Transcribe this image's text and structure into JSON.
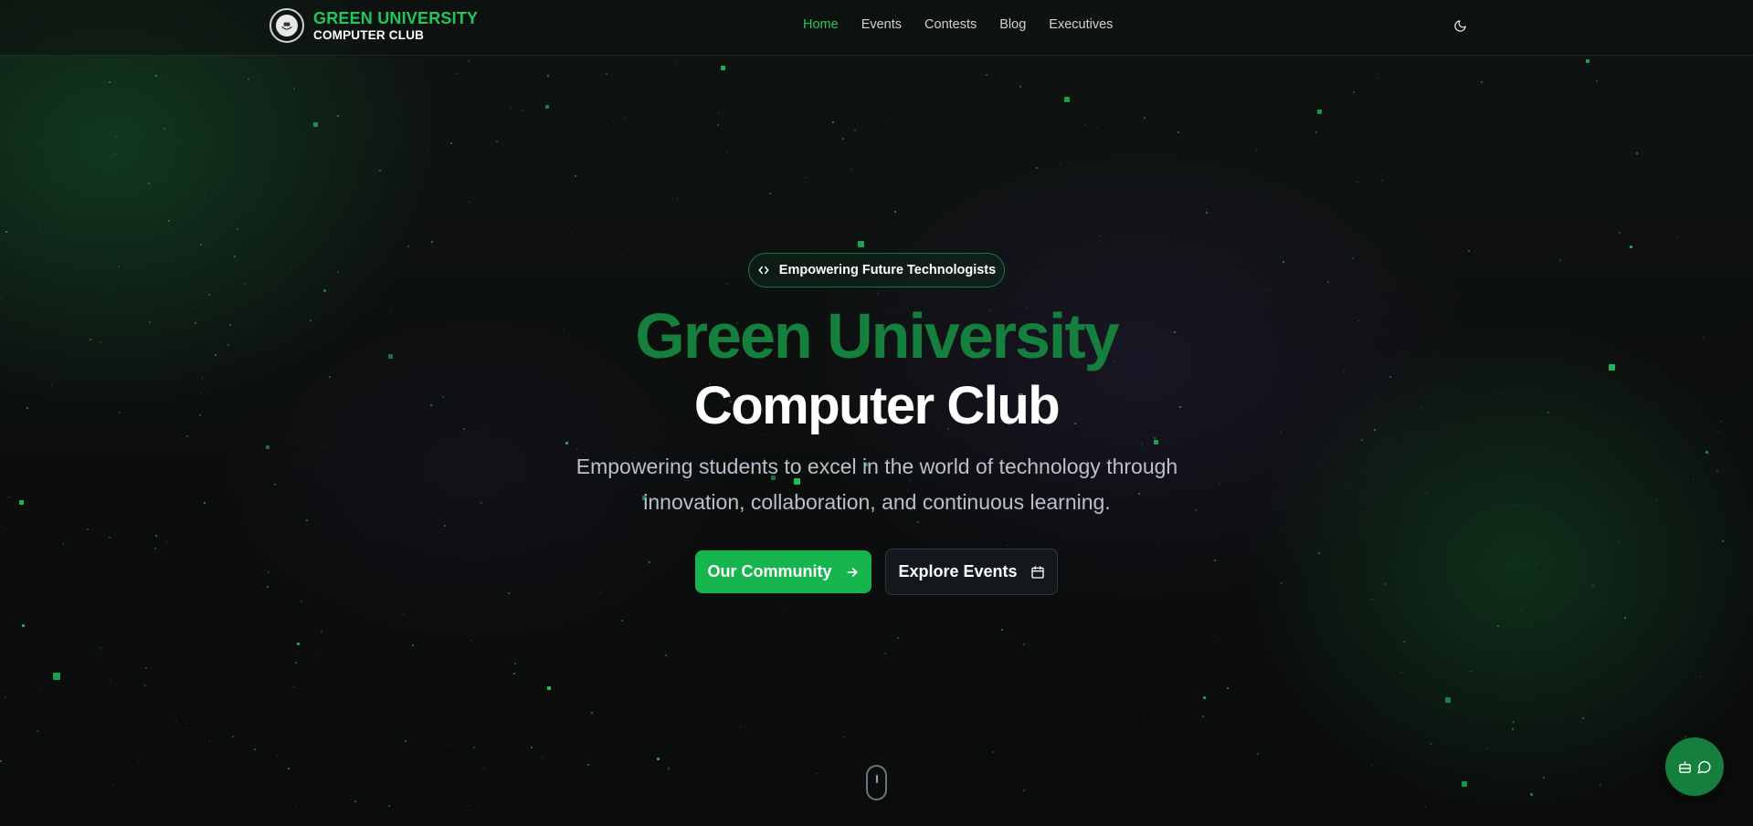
{
  "brand": {
    "line1": "GREEN UNIVERSITY",
    "line2": "COMPUTER CLUB",
    "logo_icon": "club-crest-icon"
  },
  "nav": {
    "items": [
      {
        "label": "Home",
        "active": true
      },
      {
        "label": "Events",
        "active": false
      },
      {
        "label": "Contests",
        "active": false
      },
      {
        "label": "Blog",
        "active": false
      },
      {
        "label": "Executives",
        "active": false
      }
    ],
    "theme_toggle_icon": "moon-icon"
  },
  "hero": {
    "badge": "Empowering Future Technologists",
    "badge_icon": "code-icon",
    "title_line1": "Green University",
    "title_line2": "Computer Club",
    "subtitle": "Empowering students to excel in the world of technology through innovation, collaboration, and continuous learning.",
    "primary_button": "Our Community",
    "primary_icon": "arrow-right-icon",
    "secondary_button": "Explore Events",
    "secondary_icon": "calendar-icon"
  },
  "floating": {
    "chat_icons": [
      "bot-icon",
      "message-icon"
    ]
  },
  "colors": {
    "accent": "#22c55e",
    "accent_dark": "#15803d",
    "background": "#0d0f0e"
  }
}
